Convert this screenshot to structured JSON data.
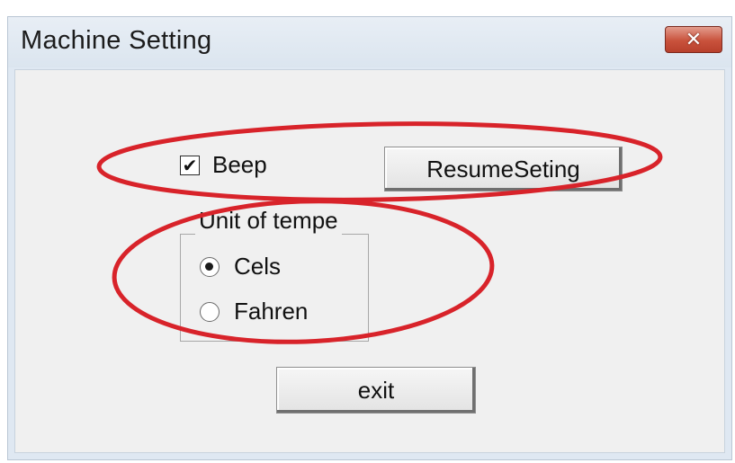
{
  "window": {
    "title": "Machine Setting",
    "close_icon": "close-icon"
  },
  "settings": {
    "beep_label": "Beep",
    "beep_checked": true,
    "resume_button_label": "ResumeSeting",
    "temperature_group_label": "Unit of tempe",
    "options": [
      {
        "label": "Cels",
        "selected": true
      },
      {
        "label": "Fahren",
        "selected": false
      }
    ],
    "exit_button_label": "exit"
  },
  "annotations": {
    "ellipse_color": "#d8232a"
  }
}
